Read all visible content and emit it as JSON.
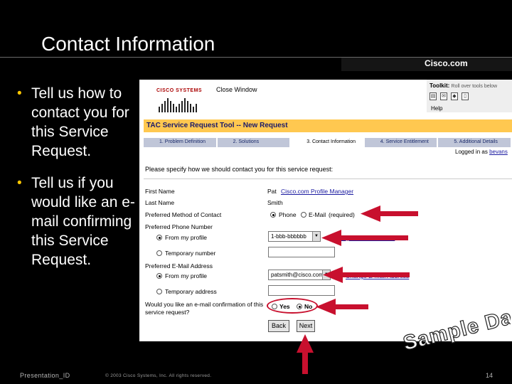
{
  "slide": {
    "title": "Contact Information",
    "brand": "Cisco.com",
    "bullets": [
      "Tell us how to contact you for this Service Request.",
      "Tell us if you would like an e-mail confirming this Service Request."
    ],
    "stamp": "Sample Data",
    "footer_left": "Presentation_ID",
    "footer_center": "© 2003 Cisco Systems, Inc. All rights reserved.",
    "page_number": "14"
  },
  "window": {
    "logo": "CISCO SYSTEMS",
    "close_link": "Close Window",
    "toolkit_label": "Toolkit:",
    "toolkit_sub": "Roll over tools below",
    "help_link": "Help",
    "tool_header": "TAC Service Request Tool -- New Request",
    "tabs": [
      "1. Problem Definition",
      "2. Solutions",
      "3. Contact Information",
      "4. Service Entitlement",
      "5. Additional Details"
    ],
    "active_tab_index": 2,
    "logged_in_label": "Logged in as",
    "logged_in_user": "bevans",
    "instruction": "Please specify how we should contact you for this service request:"
  },
  "form": {
    "first_name_label": "First Name",
    "first_name_value": "Pat",
    "profile_link": "Cisco.com Profile Manager",
    "last_name_label": "Last Name",
    "last_name_value": "Smith",
    "method_label": "Preferred Method of Contact",
    "method_options": [
      "Phone",
      "E-Mail"
    ],
    "method_selected": "Phone",
    "required_note": "(required)",
    "phone_label": "Preferred Phone Number",
    "phone_from_profile": "From my profile",
    "phone_temporary": "Temporary number",
    "phone_value": "1-bbb-bbbbbb",
    "phone_link": "Change Phone Number",
    "email_label": "Preferred E-Mail Address",
    "email_from_profile": "From my profile",
    "email_temporary": "Temporary address",
    "email_value": "patsmith@cisco.com",
    "email_link": "Change E-Mail Address",
    "confirm_question_1": "Would you like an e-mail confirmation of this",
    "confirm_question_2": "service request?",
    "confirm_options": [
      "Yes",
      "No"
    ],
    "confirm_selected": "No",
    "back_button": "Back",
    "next_button": "Next"
  },
  "colors": {
    "background": "#000000",
    "bullet_marker": "#ffc800",
    "arrow": "#c8102e",
    "tool_header": "#ffc850",
    "tab_bar": "#c0c6d8",
    "link": "#1a1aa0"
  }
}
